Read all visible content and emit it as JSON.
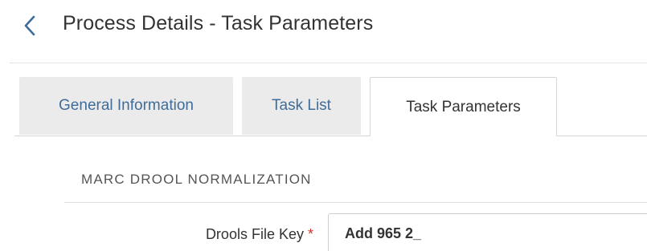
{
  "header": {
    "back_icon": "chevron-left-icon",
    "title": "Process Details - Task Parameters"
  },
  "tabs": [
    {
      "label": "General Information",
      "active": false
    },
    {
      "label": "Task List",
      "active": false
    },
    {
      "label": "Task Parameters",
      "active": true
    }
  ],
  "section": {
    "heading": "MARC DROOL NORMALIZATION"
  },
  "form": {
    "drools_file_key": {
      "label": "Drools File Key",
      "required_marker": "*",
      "value": "Add 965 2_"
    }
  },
  "colors": {
    "accent_link": "#3f6d9a",
    "required": "#d9322d",
    "tab_inactive_bg": "#ebebeb"
  }
}
